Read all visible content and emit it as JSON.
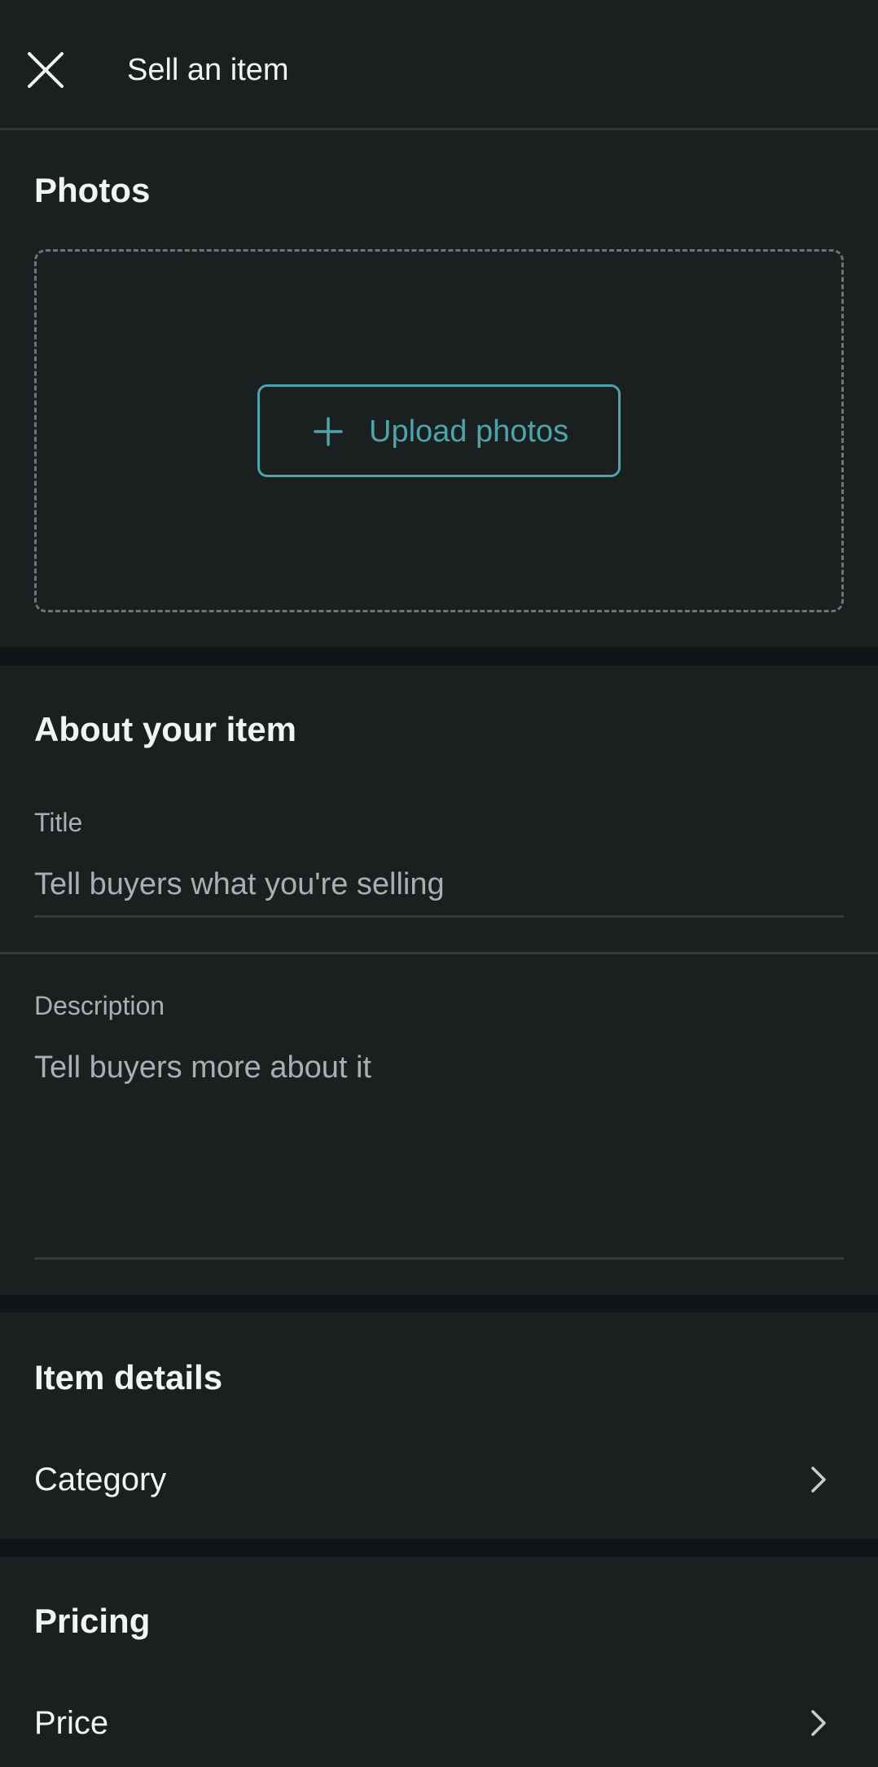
{
  "header": {
    "title": "Sell an item",
    "close_icon": "close-icon"
  },
  "photos": {
    "title": "Photos",
    "upload_label": "Upload photos",
    "upload_icon": "plus-icon"
  },
  "about": {
    "title": "About your item",
    "title_field": {
      "label": "Title",
      "placeholder": "Tell buyers what you're selling"
    },
    "description_field": {
      "label": "Description",
      "placeholder": "Tell buyers more about it"
    }
  },
  "item_details": {
    "title": "Item details",
    "category_label": "Category",
    "chevron_icon": "chevron-right-icon"
  },
  "pricing": {
    "title": "Pricing",
    "price_label": "Price",
    "chevron_icon": "chevron-right-icon"
  },
  "colors": {
    "background": "#1a1f20",
    "section_gap": "#111517",
    "accent": "#4fa3ab",
    "text_primary": "#f2f4f4",
    "text_secondary": "#a8b0b2"
  }
}
